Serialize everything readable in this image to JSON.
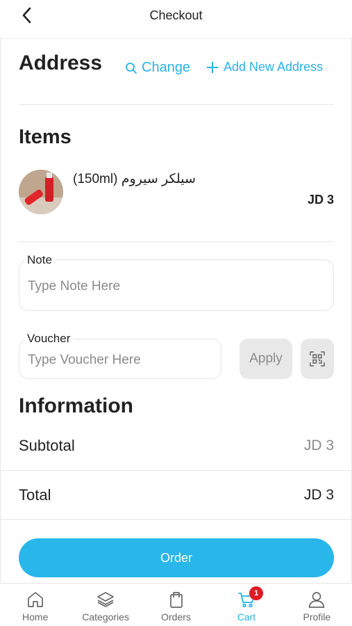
{
  "header": {
    "title": "Checkout"
  },
  "address": {
    "title": "Address",
    "change_label": "Change",
    "add_label": "Add New Address"
  },
  "items": {
    "title": "Items",
    "list": [
      {
        "name": "(150ml) سيلكر سيروم",
        "price": "JD 3"
      }
    ]
  },
  "note": {
    "label": "Note",
    "placeholder": "Type Note Here",
    "value": ""
  },
  "voucher": {
    "label": "Voucher",
    "placeholder": "Type Voucher Here",
    "value": "",
    "apply_label": "Apply"
  },
  "information": {
    "title": "Information",
    "subtotal_label": "Subtotal",
    "subtotal_value": "JD 3",
    "total_label": "Total",
    "total_value": "JD 3"
  },
  "order_button": "Order",
  "nav": {
    "items": [
      {
        "label": "Home",
        "icon": "home-icon"
      },
      {
        "label": "Categories",
        "icon": "layers-icon"
      },
      {
        "label": "Orders",
        "icon": "bag-icon"
      },
      {
        "label": "Cart",
        "icon": "cart-icon",
        "active": true,
        "badge": "1"
      },
      {
        "label": "Profile",
        "icon": "user-icon"
      }
    ]
  },
  "colors": {
    "accent": "#27b3e7",
    "badge": "#e01b24",
    "button_bg": "#29b6ea"
  }
}
